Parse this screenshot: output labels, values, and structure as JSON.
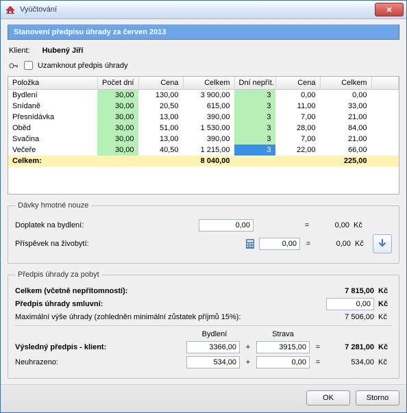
{
  "window": {
    "title": "Vyúčtování",
    "close_glyph": "✕"
  },
  "banner": "Stanovení předpisu úhrady za červen 2013",
  "client": {
    "label": "Klient:",
    "name": "Hubený Jiří"
  },
  "lock": {
    "label": "Uzamknout předpis úhrady",
    "checked": false
  },
  "grid": {
    "columns": [
      "Položka",
      "Počet dní",
      "Cena",
      "Celkem",
      "Dní nepřít.",
      "Cena",
      "Celkem"
    ],
    "rows": [
      {
        "polozka": "Bydlení",
        "pocet": "30,00",
        "cena": "130,00",
        "celkem": "3 900,00",
        "dni": "3",
        "cena2": "0,00",
        "celkem2": "0,00"
      },
      {
        "polozka": "Snídaně",
        "pocet": "30,00",
        "cena": "20,50",
        "celkem": "615,00",
        "dni": "3",
        "cena2": "11,00",
        "celkem2": "33,00"
      },
      {
        "polozka": "Přesnídávka",
        "pocet": "30,00",
        "cena": "13,00",
        "celkem": "390,00",
        "dni": "3",
        "cena2": "7,00",
        "celkem2": "21,00"
      },
      {
        "polozka": "Oběd",
        "pocet": "30,00",
        "cena": "51,00",
        "celkem": "1 530,00",
        "dni": "3",
        "cena2": "28,00",
        "celkem2": "84,00"
      },
      {
        "polozka": "Svačina",
        "pocet": "30,00",
        "cena": "13,00",
        "celkem": "390,00",
        "dni": "3",
        "cena2": "7,00",
        "celkem2": "21,00"
      },
      {
        "polozka": "Večeře",
        "pocet": "30,00",
        "cena": "40,50",
        "celkem": "1 215,00",
        "dni": "3",
        "cena2": "22,00",
        "celkem2": "66,00",
        "selected": true
      }
    ],
    "total": {
      "label": "Celkem:",
      "celkem": "8 040,00",
      "celkem2": "225,00"
    }
  },
  "nouze": {
    "legend": "Dávky hmotné nouze",
    "doplatek_label": "Doplatek na bydlení:",
    "doplatek_value": "0,00",
    "doplatek_eq": "=",
    "doplatek_out": "0,00",
    "prispevek_label": "Příspěvek na živobytí:",
    "prispevek_value": "0,00",
    "prispevek_eq": "=",
    "prispevek_out": "0,00",
    "kc": "Kč"
  },
  "predpis": {
    "legend": "Předpis úhrady za pobyt",
    "celkem_label": "Celkem (včetně nepřítomností):",
    "celkem_value": "7 815,00",
    "smluvni_label": "Předpis úhrady smluvní:",
    "smluvni_value": "0,00",
    "max_label": "Maximální výše úhrady (zohledněn minimální zůstatek příjmů 15%):",
    "max_value": "7 506,00",
    "hdr_bydleni": "Bydlení",
    "hdr_strava": "Strava",
    "vysledny_label": "Výsledný předpis - klient:",
    "vysl_bydleni": "3366,00",
    "vysl_strava": "3915,00",
    "vysl_total": "7 281,00",
    "neuhrazeno_label": "Neuhrazeno:",
    "neu_bydleni": "534,00",
    "neu_strava": "0,00",
    "neu_total": "534,00",
    "plus": "+",
    "eq": "=",
    "kc": "Kč"
  },
  "buttons": {
    "ok": "OK",
    "storno": "Storno"
  }
}
